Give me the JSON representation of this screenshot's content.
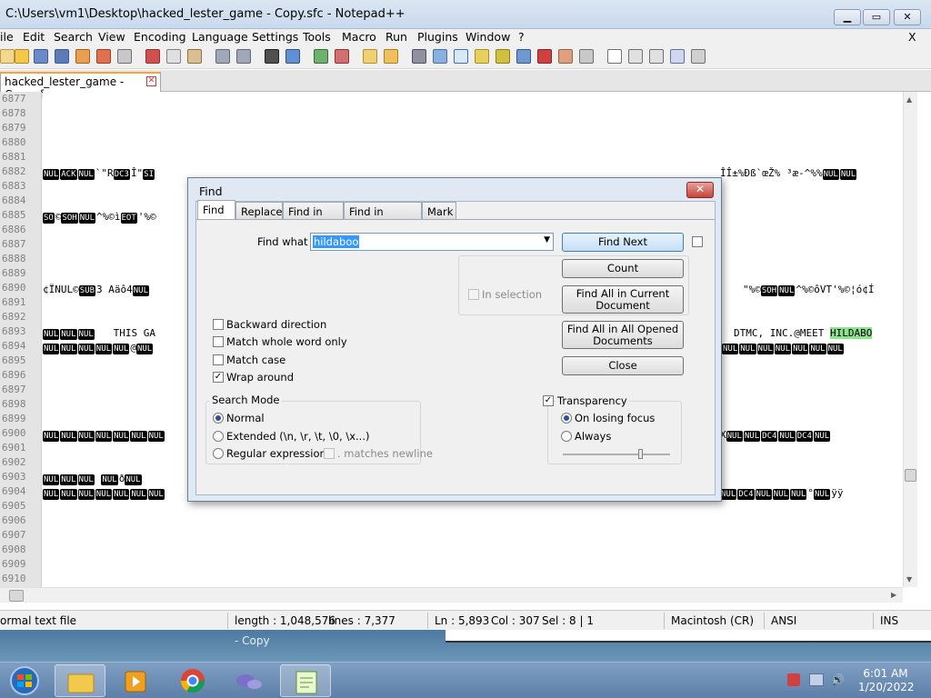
{
  "window": {
    "title": "C:\\Users\\vm1\\Desktop\\hacked_lester_game - Copy.sfc - Notepad++",
    "min": "▁",
    "max": "▭",
    "close": "✕"
  },
  "menu": [
    "ile",
    "Edit",
    "Search",
    "View",
    "Encoding",
    "Language",
    "Settings",
    "Tools",
    "Macro",
    "Run",
    "Plugins",
    "Window",
    "?"
  ],
  "menu_close": "X",
  "tab": {
    "label": "hacked_lester_game - Copy.sfc",
    "close": "✕"
  },
  "gutter": [
    "6877",
    "6878",
    "6879",
    "6880",
    "6881",
    "6882",
    "6883",
    "6884",
    "6885",
    "6886",
    "6887",
    "6888",
    "6889",
    "6890",
    "6891",
    "6892",
    "6893",
    "6894",
    "6895",
    "6896",
    "6897",
    "6898",
    "6899",
    "6900",
    "6901",
    "6902",
    "6903",
    "6904",
    "6905",
    "6906",
    "6907",
    "6908",
    "6909",
    "6910"
  ],
  "editor": {
    "l6882_a": "ACK",
    "l6882_b": "`\"R",
    "l6882_c": "DC3",
    "l6882_d": "Î\"",
    "l6882_tail": "ÎÎ±%Ðß`œŽ% ³æ-^%%",
    "l6885_a": "SO",
    "l6885_b": "©",
    "l6885_c": "SOH",
    "l6885_d": "^%©ì",
    "l6885_e": "EOT",
    "l6885_f": "'%©",
    "l6890_a": "¢ÏNUL©",
    "l6890_b": "SUB",
    "l6890_c": "3 Aäô4",
    "l6890_tail": "\"%©",
    "l6890_tail2": "SOH",
    "l6890_tail3": "^%©ôVT'%©¦ó¢Í",
    "l6893_text": "THIS GA",
    "l6893_right": "DTMC, INC.@MEET",
    "l6893_hl": "HILDABO",
    "l6894_mid": "@",
    "l6903_mid": "ð",
    "l6904_right": "°",
    "l6904_end": "ÿÿ",
    "nul": "NUL",
    "dc4": "DC4",
    "si": "SI",
    "x": "X"
  },
  "status": {
    "type": "ormal text file",
    "length": "length : 1,048,576",
    "lines": "lines : 7,377",
    "ln": "Ln : 5,893",
    "col": "Col : 307",
    "sel": "Sel : 8 | 1",
    "eol": "Macintosh (CR)",
    "enc": "ANSI",
    "ins": "INS"
  },
  "desktop_ghost": "- Copy",
  "find": {
    "title": "Find",
    "close": "✕",
    "tabs": [
      "Find",
      "Replace",
      "Find in Files",
      "Find in Projects",
      "Mark"
    ],
    "find_what_label": "Find what :",
    "find_what_value": "hildaboo",
    "buttons": {
      "find_next": "Find Next",
      "count": "Count",
      "find_all_current": "Find All in Current Document",
      "find_all_opened": "Find All in All Opened Documents",
      "close": "Close"
    },
    "in_selection": "In selection",
    "options": {
      "backward": "Backward direction",
      "whole_word": "Match whole word only",
      "match_case": "Match case",
      "wrap": "Wrap around"
    },
    "search_mode": {
      "title": "Search Mode",
      "normal": "Normal",
      "extended": "Extended (\\n, \\r, \\t, \\0, \\x...)",
      "regex": "Regular expression",
      "matches_newline": ". matches newline"
    },
    "transparency": {
      "title": "Transparency",
      "on_losing_focus": "On losing focus",
      "always": "Always"
    },
    "check": "✓"
  },
  "clock": {
    "time": "6:01 AM",
    "date": "1/20/2022"
  },
  "colors": {
    "accent": "#3399ff",
    "highlight": "#8fe38f",
    "tab_accent": "#f9a33a"
  }
}
